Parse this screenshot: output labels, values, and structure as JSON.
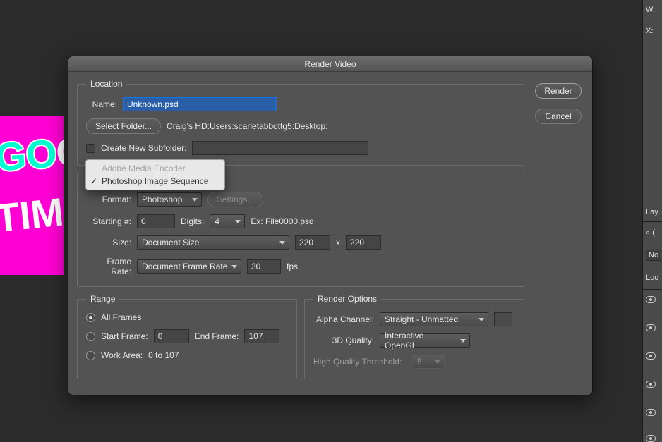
{
  "dialog": {
    "title": "Render Video",
    "buttons": {
      "render": "Render",
      "cancel": "Cancel"
    },
    "location": {
      "legend": "Location",
      "name_label": "Name:",
      "name_value": "Unknown.psd",
      "select_folder_label": "Select Folder...",
      "folder_path": "Craig's HD:Users:scarletabbottg5:Desktop:",
      "subfolder_checkbox_label": "Create New Subfolder:",
      "subfolder_value": ""
    },
    "encoder_dropdown": {
      "options": [
        "Adobe Media Encoder",
        "Photoshop Image Sequence"
      ],
      "selected_index": 1
    },
    "sequence": {
      "format_label": "Format:",
      "format_value": "Photoshop",
      "settings_label": "Settings...",
      "starting_label": "Starting #:",
      "starting_value": "0",
      "digits_label": "Digits:",
      "digits_value": "4",
      "example_label": "Ex: File0000.psd",
      "size_label": "Size:",
      "size_value": "Document Size",
      "width_value": "220",
      "x_label": "x",
      "height_value": "220",
      "framerate_label": "Frame Rate:",
      "framerate_preset": "Document Frame Rate",
      "framerate_value": "30",
      "framerate_unit": "fps"
    },
    "range": {
      "legend": "Range",
      "all_frames": "All Frames",
      "start_frame_label": "Start Frame:",
      "start_frame_value": "0",
      "end_frame_label": "End Frame:",
      "end_frame_value": "107",
      "work_area_label": "Work Area:",
      "work_area_value": "0 to 107"
    },
    "render_options": {
      "legend": "Render Options",
      "alpha_label": "Alpha Channel:",
      "alpha_value": "Straight - Unmatted",
      "quality_label": "3D Quality:",
      "quality_value": "Interactive OpenGL",
      "hq_threshold_label": "High Quality Threshold:",
      "hq_threshold_value": "5"
    }
  },
  "right_panel": {
    "w_label": "W:",
    "x_label": "X:",
    "layers_tab": "Lay",
    "search_icon": "⌕",
    "kind_label": "No",
    "lock_label": "Loc"
  }
}
